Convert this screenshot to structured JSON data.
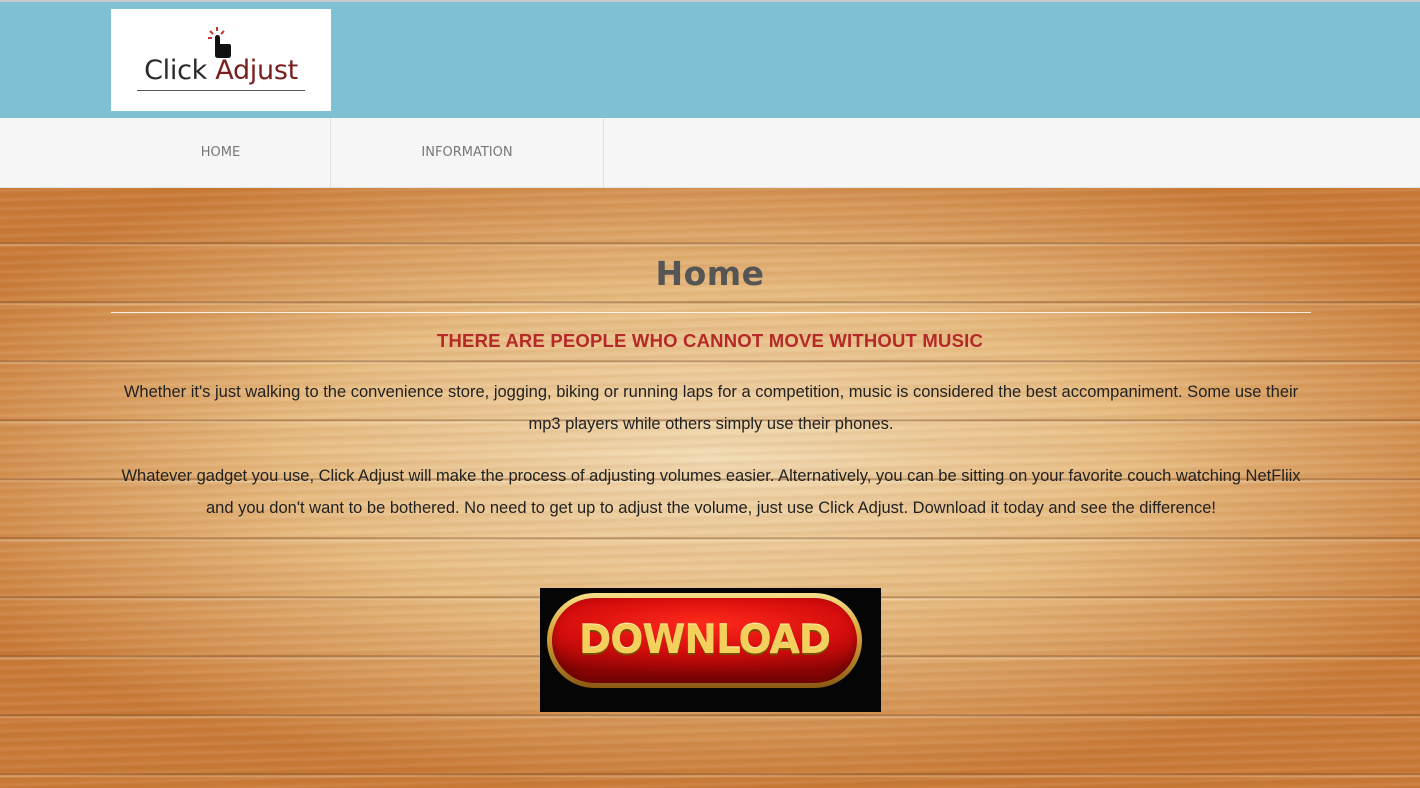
{
  "header": {
    "logo": {
      "text_part1": "Click",
      "text_part2": "Adjust",
      "icon": "pointing-hand-icon"
    },
    "bg_color": "#7ec1d2"
  },
  "nav": {
    "items": [
      {
        "label": "HOME"
      },
      {
        "label": "INFORMATION"
      }
    ]
  },
  "main": {
    "title": "Home",
    "headline": "THERE ARE PEOPLE WHO CANNOT MOVE WITHOUT MUSIC",
    "headline_color": "#b52a28",
    "paragraphs": [
      "Whether it's just walking to the convenience store, jogging, biking or running laps for a competition, music is considered the best accompaniment. Some use their mp3 players while others simply use their phones.",
      "Whatever gadget you use, Click Adjust will make the process of adjusting volumes easier. Alternatively, you can be sitting on your favorite couch watching NetFliix and you don't want to be bothered. No need to get up to adjust the volume, just use Click Adjust. Download it today and see the difference!"
    ],
    "download_label": "DOWNLOAD"
  }
}
